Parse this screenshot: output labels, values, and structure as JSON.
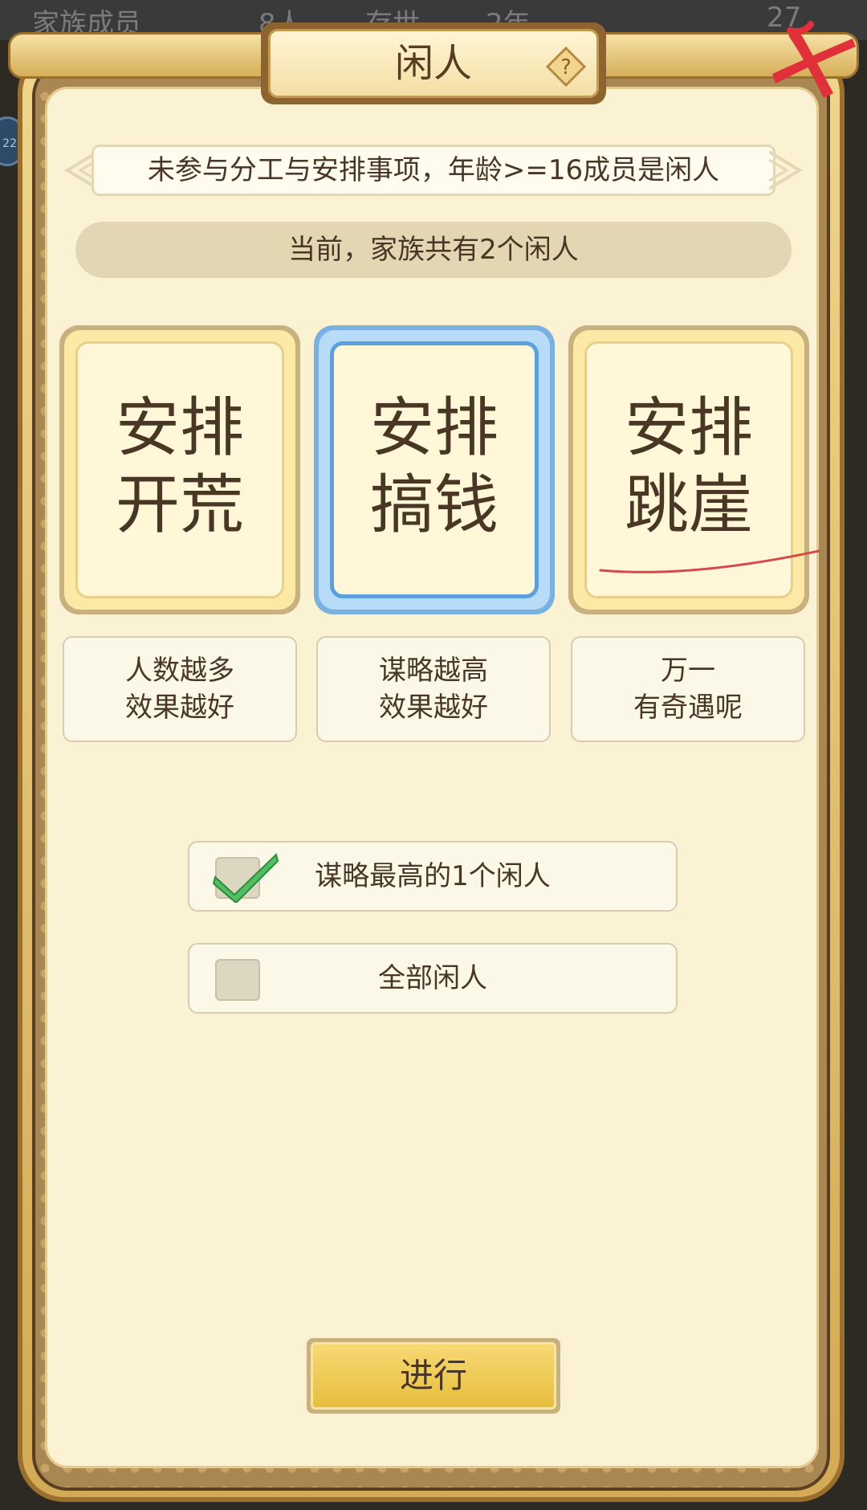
{
  "background_bar": {
    "member_label": "家族成员",
    "member_count": "8人",
    "existence_label": "存世",
    "existence_value": "2年",
    "currency_value": "27",
    "side_badge": "22"
  },
  "dialog": {
    "title": "闲人",
    "description": "未参与分工与安排事项，年龄>=16成员是闲人",
    "status": "当前，家族共有2个闲人"
  },
  "options": [
    {
      "line1": "安排",
      "line2": "开荒",
      "note1": "人数越多",
      "note2": "效果越好",
      "selected": false
    },
    {
      "line1": "安排",
      "line2": "搞钱",
      "note1": "谋略越高",
      "note2": "效果越好",
      "selected": true
    },
    {
      "line1": "安排",
      "line2": "跳崖",
      "note1": "万一",
      "note2": "有奇遇呢",
      "selected": false
    }
  ],
  "scope": {
    "top_strategist": {
      "label": "谋略最高的1个闲人",
      "checked": true
    },
    "all_idle": {
      "label": "全部闲人",
      "checked": false
    }
  },
  "proceed_button": "进行",
  "colors": {
    "accent_gold": "#e7bd3c",
    "selected_blue": "#5aa0dc",
    "text_brown": "#4a3624",
    "annotation_red": "#d44a4a",
    "close_red": "#e0303a"
  },
  "icons": {
    "help": "question-diamond-icon",
    "close": "close-x-icon",
    "check": "check-icon"
  }
}
